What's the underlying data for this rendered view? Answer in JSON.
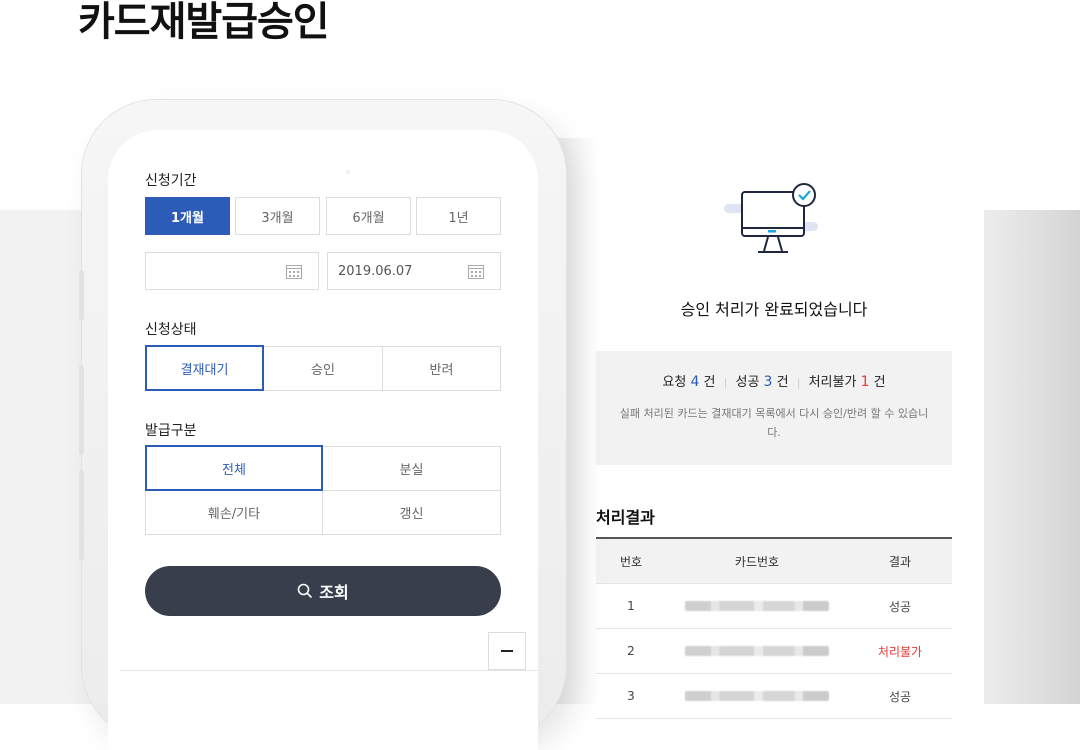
{
  "page": {
    "title": "카드재발급승인"
  },
  "form": {
    "period": {
      "label": "신청기간",
      "options": [
        "1개월",
        "3개월",
        "6개월",
        "1년"
      ],
      "selected": "1개월",
      "start_date": "",
      "end_date": "2019.06.07"
    },
    "status": {
      "label": "신청상태",
      "options": [
        "결재대기",
        "승인",
        "반려"
      ],
      "selected": "결재대기"
    },
    "issue_type": {
      "label": "발급구분",
      "options": [
        "전체",
        "분실",
        "훼손/기타",
        "갱신"
      ],
      "selected": "전체"
    },
    "search_label": "조회"
  },
  "result": {
    "message": "승인 처리가 완료되었습니다",
    "summary": {
      "request_label": "요청",
      "request_count": "4",
      "success_label": "성공",
      "success_count": "3",
      "fail_label": "처리불가",
      "fail_count": "1",
      "unit": "건"
    },
    "note": "실패 처리된 카드는 결재대기 목록에서 다시 승인/반려 할 수 있습니다.",
    "table_title": "처리결과",
    "columns": [
      "번호",
      "카드번호",
      "결과"
    ],
    "rows": [
      {
        "no": "1",
        "result": "성공"
      },
      {
        "no": "2",
        "result": "처리불가"
      },
      {
        "no": "3",
        "result": "성공"
      }
    ]
  },
  "colors": {
    "accent": "#2d5cb8",
    "danger": "#e53935",
    "dark_button": "#383e4b"
  },
  "icons": [
    "monitor-check-icon",
    "calendar-icon",
    "search-icon",
    "minus-icon"
  ]
}
